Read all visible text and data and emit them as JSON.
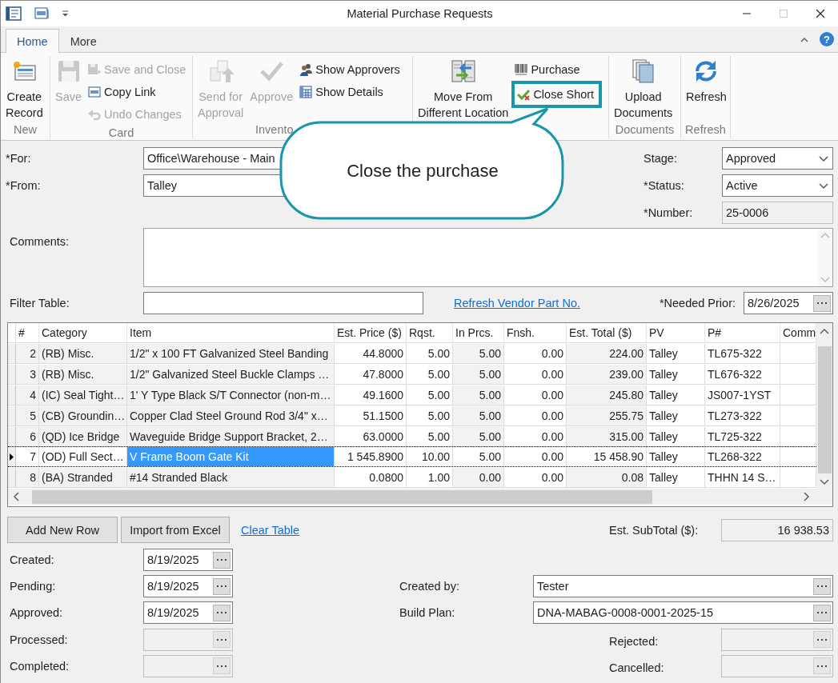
{
  "window": {
    "title": "Material Purchase Requests",
    "controls": [
      {
        "kind": "minimize",
        "disabled": false
      },
      {
        "kind": "maximize",
        "disabled": true
      },
      {
        "kind": "close",
        "disabled": false
      }
    ]
  },
  "ribbon": {
    "tabs": [
      {
        "label": "Home",
        "selected": true
      },
      {
        "label": "More",
        "selected": false
      }
    ],
    "help": "?",
    "groups": [
      {
        "label": "New",
        "items": [
          {
            "kind": "large",
            "label": "Create\nRecord",
            "disabled": false
          }
        ]
      },
      {
        "label": "Card",
        "items": [
          {
            "kind": "large",
            "label": "Save",
            "disabled": true
          },
          {
            "kind": "small",
            "label": "Save and Close",
            "disabled": true
          },
          {
            "kind": "small",
            "label": "Copy Link",
            "disabled": false
          },
          {
            "kind": "small",
            "label": "Undo Changes",
            "disabled": true
          }
        ]
      },
      {
        "label": "Invento",
        "items": [
          {
            "kind": "large",
            "label": "Send for\nApproval",
            "disabled": true
          },
          {
            "kind": "large",
            "label": "Approve",
            "disabled": true
          },
          {
            "kind": "small",
            "label": "Show Approvers",
            "disabled": false
          },
          {
            "kind": "small",
            "label": "Show Details",
            "disabled": false
          }
        ]
      },
      {
        "items": [
          {
            "kind": "large",
            "label": "Move From\nDifferent Location",
            "disabled": false
          },
          {
            "kind": "small",
            "label": "Purchase",
            "disabled": false
          },
          {
            "kind": "small",
            "label": "Close Short",
            "disabled": false,
            "highlighted": true
          }
        ]
      },
      {
        "label": "Documents",
        "items": [
          {
            "kind": "large",
            "label": "Upload\nDocuments",
            "disabled": false
          }
        ]
      },
      {
        "label": "Refresh",
        "items": [
          {
            "kind": "large",
            "label": "Refresh",
            "disabled": false
          }
        ]
      }
    ]
  },
  "form": {
    "for": {
      "label": "*For:",
      "value": "Office\\Warehouse - Main"
    },
    "from": {
      "label": "*From:",
      "value": "Talley"
    },
    "stage": {
      "label": "Stage:",
      "value": "Approved"
    },
    "status": {
      "label": "*Status:",
      "value": "Active"
    },
    "number": {
      "label": "*Number:",
      "value": "25-0006",
      "disabled": true
    },
    "comments": {
      "label": "Comments:"
    },
    "filter": {
      "label": "Filter Table:"
    },
    "refresh_link": "Refresh Vendor Part No.",
    "needed_prior": {
      "label": "*Needed Prior:",
      "value": "8/26/2025"
    }
  },
  "table": {
    "columns": [
      {
        "label": "#",
        "kind": "number",
        "readonly": true
      },
      {
        "label": "Category",
        "kind": "text",
        "readonly": true
      },
      {
        "label": "Item",
        "kind": "text",
        "readonly": true
      },
      {
        "label": "Est. Price ($)",
        "kind": "number",
        "readonly": false
      },
      {
        "label": "Rqst.",
        "kind": "number",
        "readonly": false
      },
      {
        "label": "In Prcs.",
        "kind": "number",
        "readonly": true
      },
      {
        "label": "Fnsh.",
        "kind": "number",
        "readonly": false
      },
      {
        "label": "Est. Total ($)",
        "kind": "number",
        "readonly": true
      },
      {
        "label": "PV",
        "kind": "text",
        "readonly": false
      },
      {
        "label": "P#",
        "kind": "text",
        "readonly": false
      },
      {
        "label": "Comm",
        "kind": "text",
        "readonly": false
      }
    ],
    "rows": [
      {
        "selected": false,
        "cells": [
          "2",
          "(RB) Misc.",
          "1/2\" x 100 FT Galvanized Steel Banding",
          "44.8000",
          "5.00",
          "5.00",
          "0.00",
          "224.00",
          "Talley",
          "TL675-322"
        ]
      },
      {
        "selected": false,
        "cells": [
          "3",
          "(RB) Misc.",
          "1/2\" Galvanized Steel Buckle Clamps …",
          "47.8000",
          "5.00",
          "5.00",
          "0.00",
          "239.00",
          "Talley",
          "TL676-322"
        ]
      },
      {
        "selected": false,
        "cells": [
          "4",
          "(IC) Seal Tight…",
          "1' Y Type Black S/T Connector (non-m…",
          "49.1600",
          "5.00",
          "5.00",
          "0.00",
          "245.80",
          "Talley",
          "JS007-1YST"
        ]
      },
      {
        "selected": false,
        "cells": [
          "5",
          "(CB) Groundin…",
          "Copper Clad Steel Ground Rod 3/4\" x…",
          "51.1500",
          "5.00",
          "5.00",
          "0.00",
          "255.75",
          "Talley",
          "TL273-322"
        ]
      },
      {
        "selected": false,
        "cells": [
          "6",
          "(QD) Ice Bridge",
          "Waveguide Bridge Support Bracket, 2…",
          "63.0000",
          "5.00",
          "5.00",
          "0.00",
          "315.00",
          "Talley",
          "TL725-322"
        ]
      },
      {
        "selected": true,
        "cells": [
          "7",
          "(OD) Full Sect…",
          {
            "text": "V Frame Boom Gate Kit",
            "focused": true
          },
          "1 545.8900",
          "10.00",
          "5.00",
          "0.00",
          "15 458.90",
          "Talley",
          "TL268-322"
        ]
      },
      {
        "selected": false,
        "cells": [
          "8",
          "(BA) Stranded",
          "#14 Stranded Black",
          "0.0800",
          "1.00",
          "0.00",
          "0.00",
          "0.08",
          "Talley",
          "THHN 14 S…"
        ]
      }
    ]
  },
  "footer": {
    "buttons": [
      "Add New Row",
      "Import from Excel"
    ],
    "clear_link": "Clear Table",
    "subtotal": {
      "label": "Est. SubTotal ($):",
      "value": "16 938.53"
    },
    "dates": [
      {
        "label": "Created:",
        "value": "8/19/2025",
        "disabled": false
      },
      {
        "label": "Pending:",
        "value": "8/19/2025",
        "disabled": false
      },
      {
        "label": "Approved:",
        "value": "8/19/2025",
        "disabled": false
      },
      {
        "label": "Processed:",
        "disabled": true
      },
      {
        "label": "Completed:",
        "disabled": true
      }
    ],
    "created_by": {
      "label": "Created by:",
      "value": "Tester"
    },
    "build_plan": {
      "label": "Build Plan:",
      "value": "DNA-MABAG-0008-0001-2025-15"
    },
    "rejected": {
      "label": "Rejected:",
      "disabled": true
    },
    "cancelled": {
      "label": "Cancelled:",
      "disabled": true
    }
  },
  "callout": {
    "text": "Close the purchase"
  }
}
